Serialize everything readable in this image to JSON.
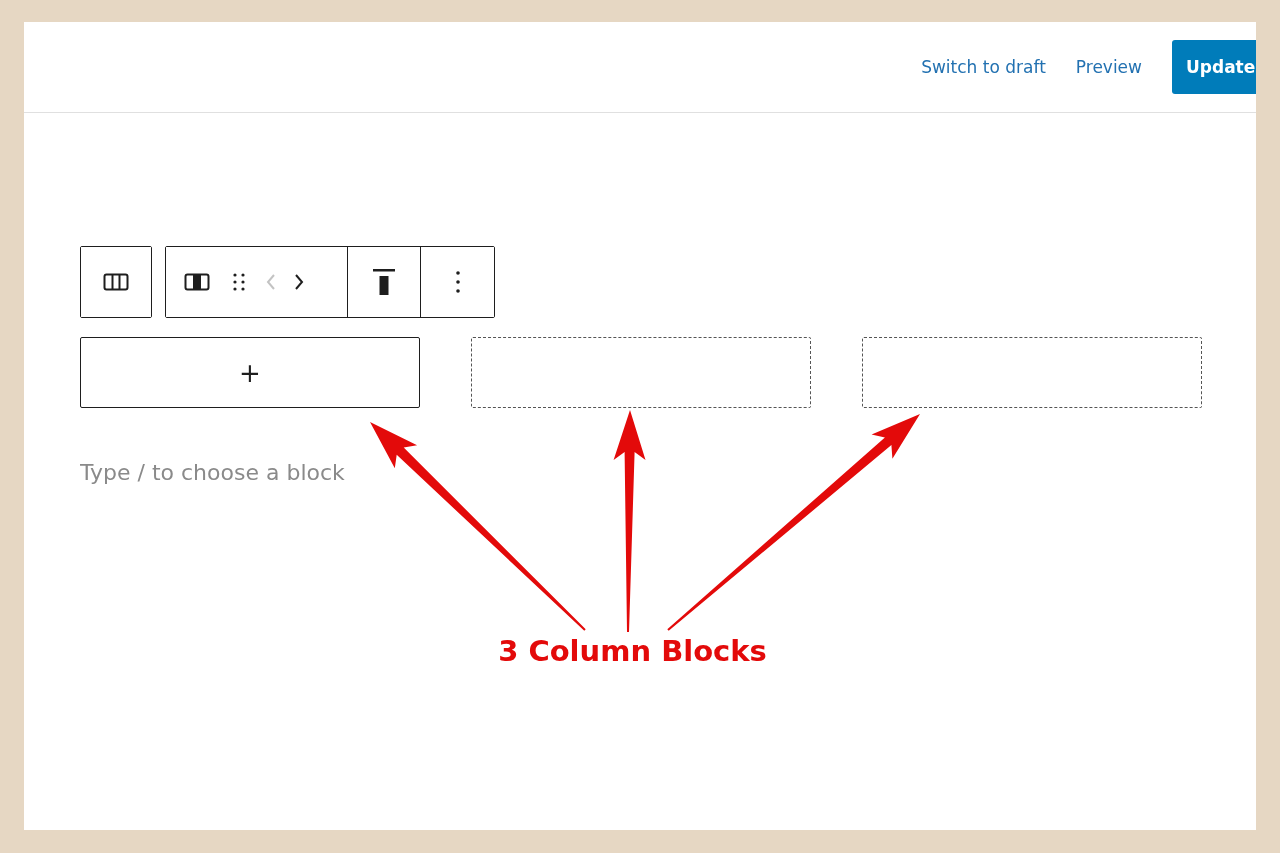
{
  "header": {
    "links": [
      "Switch to draft",
      "Preview"
    ],
    "primary_button": "Update"
  },
  "toolbar": {
    "move_previous_disabled": true
  },
  "columns": [
    {
      "selected": true,
      "appender": "+"
    },
    {
      "selected": false
    },
    {
      "selected": false
    }
  ],
  "paragraph_block": {
    "placeholder": "Type / to choose a block"
  },
  "annotation": {
    "label": "3 Column Blocks"
  }
}
